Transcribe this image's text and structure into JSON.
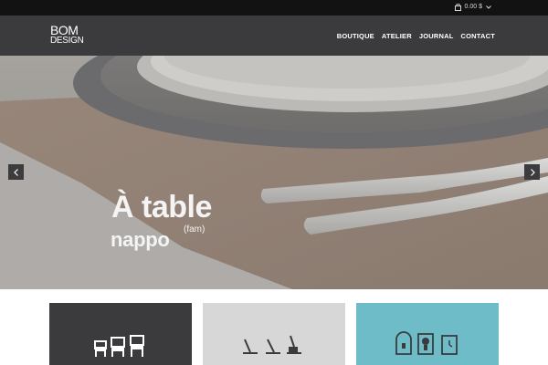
{
  "topbar": {
    "cart_icon": "shopping-bag-icon",
    "cart_amount": "0.00 $",
    "dropdown_icon": "chevron-down-icon"
  },
  "header": {
    "logo_line1": "BOM",
    "logo_line2": "DESIGN",
    "nav": [
      {
        "label": "BOUTIQUE"
      },
      {
        "label": "ATELIER"
      },
      {
        "label": "JOURNAL"
      },
      {
        "label": "CONTACT"
      }
    ]
  },
  "hero": {
    "title": "À table",
    "subtitle": "nappo",
    "superscript": "(fam)",
    "prev_icon": "chevron-left-icon",
    "next_icon": "chevron-right-icon"
  },
  "tiles": [
    {
      "icon": "chairs-icon",
      "color": "#3b3b3d"
    },
    {
      "icon": "utensils-icon",
      "color": "#d7d7d7"
    },
    {
      "icon": "frames-icon",
      "color": "#6dbcc8"
    }
  ]
}
